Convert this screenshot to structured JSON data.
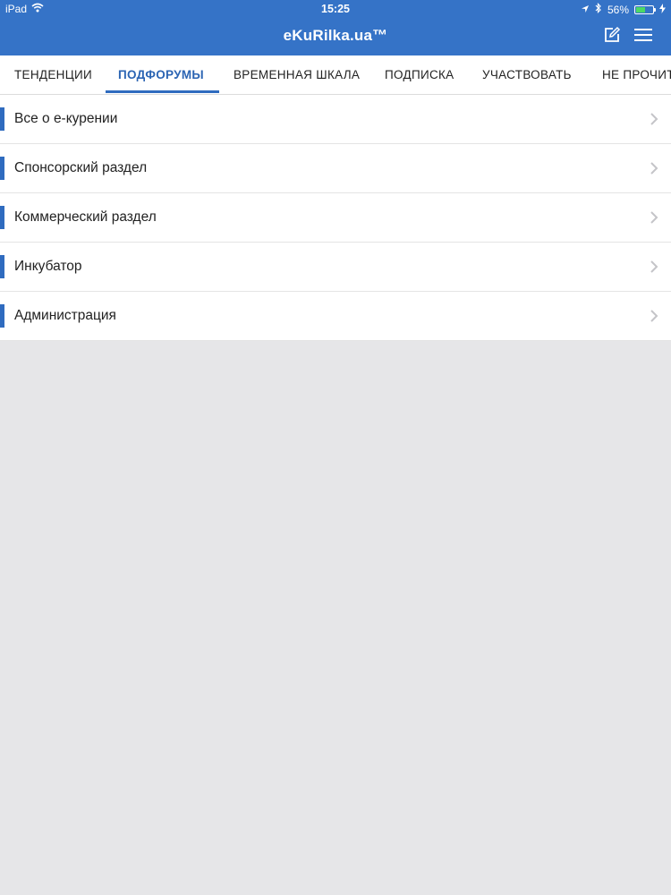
{
  "status_bar": {
    "device": "iPad",
    "time": "15:25",
    "battery": "56%",
    "battery_level": 0.56,
    "icons": [
      "wifi-icon",
      "location-arrow-icon",
      "bluetooth-icon",
      "battery-icon",
      "charging-icon"
    ]
  },
  "app": {
    "title": "eKuRilka.ua™",
    "accent_color": "#3573c7",
    "actions": [
      "compose-icon",
      "menu-icon"
    ]
  },
  "tabs": [
    {
      "label": "ТЕНДЕНЦИИ",
      "active": false
    },
    {
      "label": "ПОДФОРУМЫ",
      "active": true
    },
    {
      "label": "ВРЕМЕННАЯ ШКАЛА",
      "active": false
    },
    {
      "label": "ПОДПИСКА",
      "active": false
    },
    {
      "label": "УЧАСТВОВАТЬ",
      "active": false
    },
    {
      "label": "НЕ ПРОЧИТ",
      "active": false
    }
  ],
  "subforums": [
    {
      "label": "Все о е-курении"
    },
    {
      "label": "Спонсорский раздел"
    },
    {
      "label": "Коммерческий раздел"
    },
    {
      "label": "Инкубатор"
    },
    {
      "label": "Администрация"
    }
  ]
}
